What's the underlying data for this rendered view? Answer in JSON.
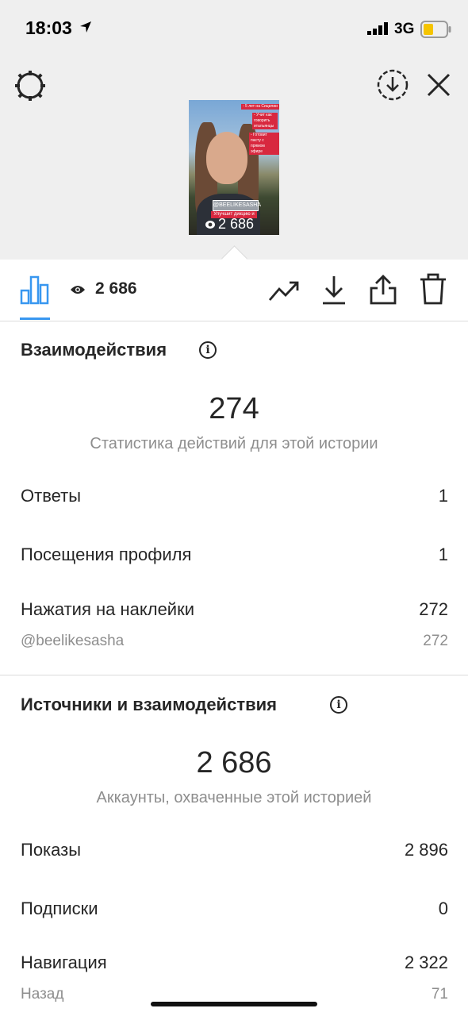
{
  "status_bar": {
    "time": "18:03",
    "network": "3G"
  },
  "preview": {
    "views": "2 686",
    "stickers": [
      "@BEELIKESASHA",
      "Улучшит дикцию и"
    ],
    "tags": [
      "- 5 лет на Сицилии",
      "- Учит как говорить итальянцы",
      "- Готовит пасту с прямом эфире"
    ]
  },
  "toolbar": {
    "view_count": "2 686"
  },
  "interactions": {
    "title": "Взаимодействия",
    "total": "274",
    "caption": "Статистика действий для этой истории",
    "rows": [
      {
        "label": "Ответы",
        "value": "1"
      },
      {
        "label": "Посещения профиля",
        "value": "1"
      },
      {
        "label": "Нажатия на наклейки",
        "value": "272"
      }
    ],
    "sub_row": {
      "label": "@beelikesasha",
      "value": "272"
    }
  },
  "discovery": {
    "title": "Источники и взаимодействия",
    "total": "2 686",
    "caption": "Аккаунты, охваченные этой историей",
    "rows": [
      {
        "label": "Показы",
        "value": "2 896"
      },
      {
        "label": "Подписки",
        "value": "0"
      },
      {
        "label": "Навигация",
        "value": "2 322"
      }
    ],
    "sub_row": {
      "label": "Назад",
      "value": "71"
    }
  },
  "colors": {
    "accent": "#3897f0",
    "tag_red": "#d8283f",
    "secondary_text": "#8e8e8e"
  }
}
